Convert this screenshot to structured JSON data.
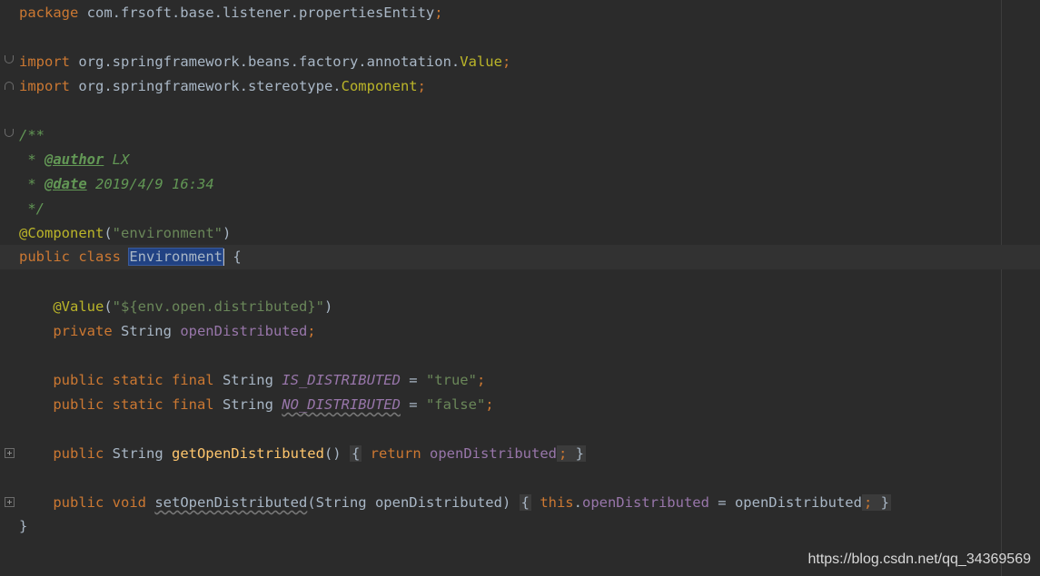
{
  "code": {
    "package_kw": "package",
    "package_name": " com.frsoft.base.listener.propertiesEntity",
    "import_kw": "import",
    "import1_path": " org.springframework.beans.factory.annotation.",
    "import1_class": "Value",
    "import2_path": " org.springframework.stereotype.",
    "import2_class": "Component",
    "semicolon": ";",
    "doc_open": "/**",
    "doc_star": " * ",
    "author_tag": "@author",
    "author_value": " LX",
    "date_tag": "@date",
    "date_value": " 2019/4/9 16:34",
    "doc_close": " */",
    "component_ann": "@Component",
    "component_arg": "\"environment\"",
    "class_decl": "public class ",
    "class_name": "Environment",
    "open_brace": " {",
    "value_ann": "@Value",
    "value_arg": "\"${env.open.distributed}\"",
    "private_kw": "private ",
    "string_type": "String ",
    "field_name": "openDistributed",
    "psf_kw": "public static final ",
    "is_dist_name": "IS_DISTRIBUTED",
    "is_dist_value": "\"true\"",
    "no_dist_name": "NO_DISTRIBUTED",
    "no_dist_value": "\"false\"",
    "assign": " = ",
    "public_kw": "public ",
    "getter_name": "getOpenDistributed",
    "getter_params": "()",
    "return_kw": "return ",
    "void_kw": "void ",
    "setter_name": "setOpenDistributed",
    "setter_params": "(String openDistributed)",
    "this_kw": "this",
    "setter_assign": " = openDistributed",
    "close_brace": "}"
  },
  "watermark": "https://blog.csdn.net/qq_34369569",
  "colors": {
    "background": "#2b2b2b",
    "keyword": "#cc7832",
    "annotation": "#bbb529",
    "string": "#6a8759",
    "field": "#9876aa",
    "method": "#ffc66d",
    "doc": "#629755",
    "text": "#a9b7c6",
    "selection": "#214283"
  }
}
